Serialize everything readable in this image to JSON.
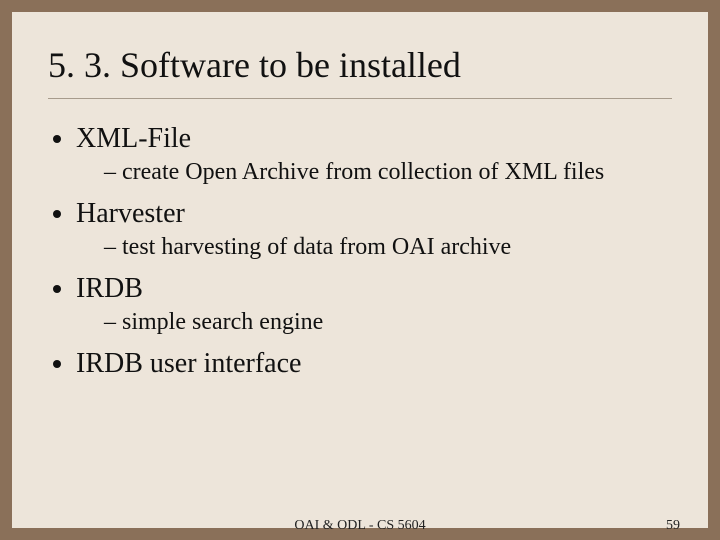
{
  "title": "5. 3. Software to be installed",
  "bullets": [
    {
      "text": "XML-File",
      "sub": [
        "create Open Archive from collection of XML files"
      ]
    },
    {
      "text": "Harvester",
      "sub": [
        "test harvesting of data from OAI archive"
      ]
    },
    {
      "text": "IRDB",
      "sub": [
        "simple search engine"
      ]
    },
    {
      "text": "IRDB user interface",
      "sub": []
    }
  ],
  "footer": {
    "center": "OAI & ODL - CS 5604",
    "page": "59"
  }
}
